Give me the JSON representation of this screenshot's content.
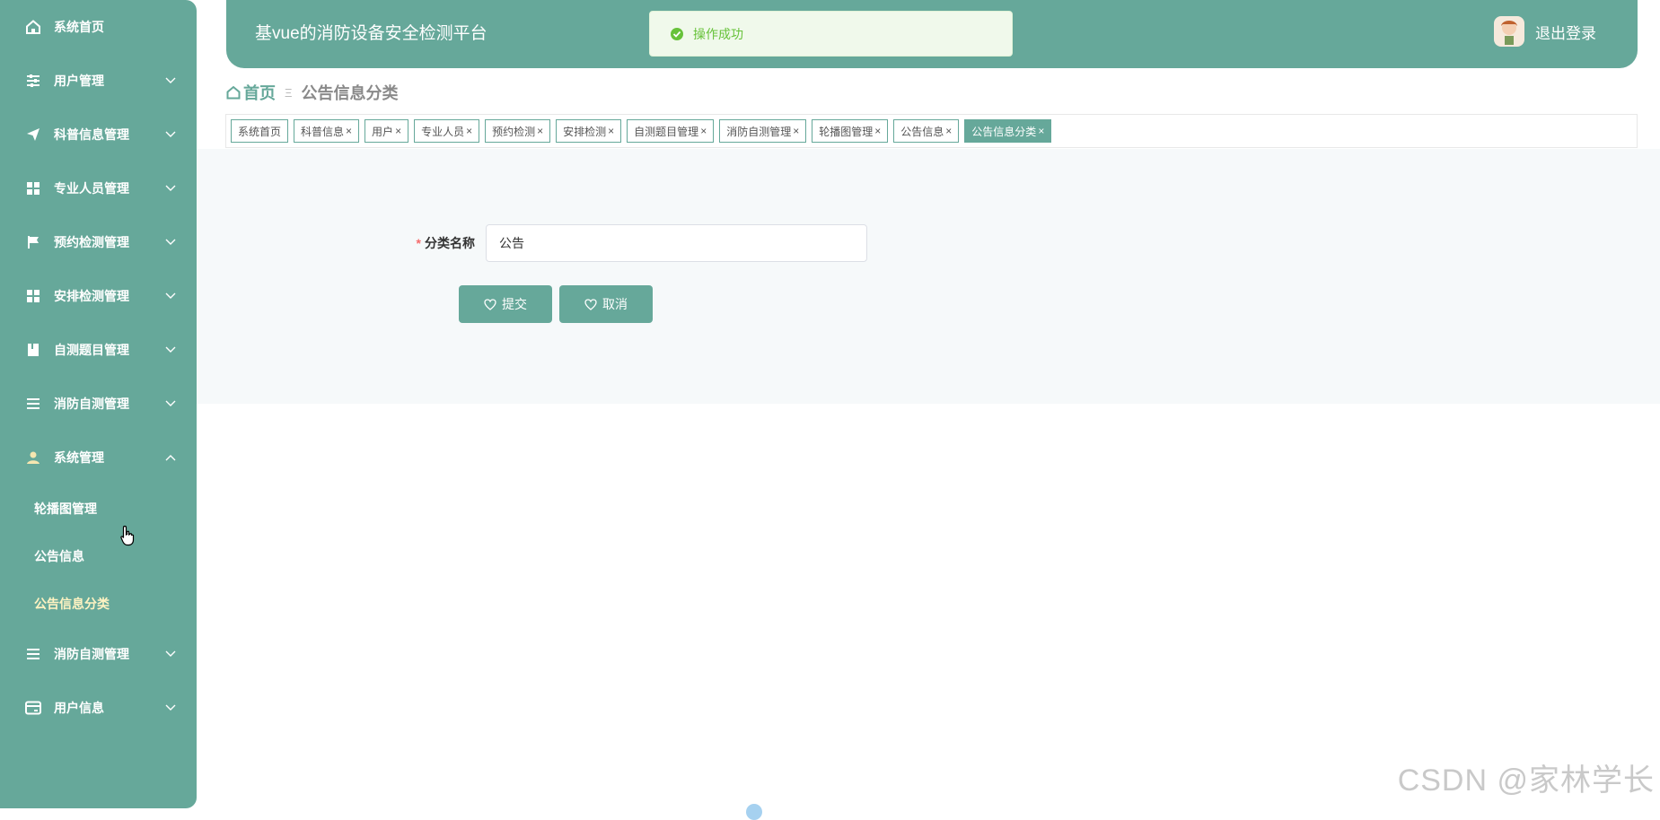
{
  "app": {
    "title": "基vue的消防设备安全检测平台",
    "logout_label": "退出登录"
  },
  "toast": {
    "message": "操作成功",
    "color": "#67c23a"
  },
  "theme": {
    "primary": "#66a89a",
    "content_bg": "#f6f9fa"
  },
  "sidebar": {
    "items": [
      {
        "label": "系统首页",
        "icon": "home-icon"
      },
      {
        "label": "用户管理",
        "icon": "sliders-icon"
      },
      {
        "label": "科普信息管理",
        "icon": "send-icon"
      },
      {
        "label": "专业人员管理",
        "icon": "grid-icon"
      },
      {
        "label": "预约检测管理",
        "icon": "flag-icon"
      },
      {
        "label": "安排检测管理",
        "icon": "grid-icon"
      },
      {
        "label": "自测题目管理",
        "icon": "book-icon"
      },
      {
        "label": "消防自测管理",
        "icon": "list-icon"
      },
      {
        "label": "系统管理",
        "icon": "user-icon"
      },
      {
        "label": "消防自测管理",
        "icon": "list-icon"
      },
      {
        "label": "用户信息",
        "icon": "card-icon"
      }
    ],
    "system_sub": [
      {
        "label": "轮播图管理"
      },
      {
        "label": "公告信息"
      },
      {
        "label": "公告信息分类"
      }
    ]
  },
  "breadcrumb": {
    "home": "首页",
    "separator": "Ξ",
    "current": "公告信息分类"
  },
  "tags": [
    {
      "label": "系统首页",
      "close": ""
    },
    {
      "label": "科普信息",
      "close": "×"
    },
    {
      "label": "用户",
      "close": "×"
    },
    {
      "label": "专业人员",
      "close": "×"
    },
    {
      "label": "预约检测",
      "close": "×"
    },
    {
      "label": "安排检测",
      "close": "×"
    },
    {
      "label": "自测题目管理",
      "close": "×"
    },
    {
      "label": "消防自测管理",
      "close": "×"
    },
    {
      "label": "轮播图管理",
      "close": "×"
    },
    {
      "label": "公告信息",
      "close": "×"
    },
    {
      "label": "公告信息分类",
      "close": "×"
    }
  ],
  "form": {
    "required_mark": "*",
    "category_label": "分类名称",
    "category_value": "公告",
    "submit_label": "提交",
    "cancel_label": "取消"
  },
  "watermark": "CSDN @家林学长"
}
